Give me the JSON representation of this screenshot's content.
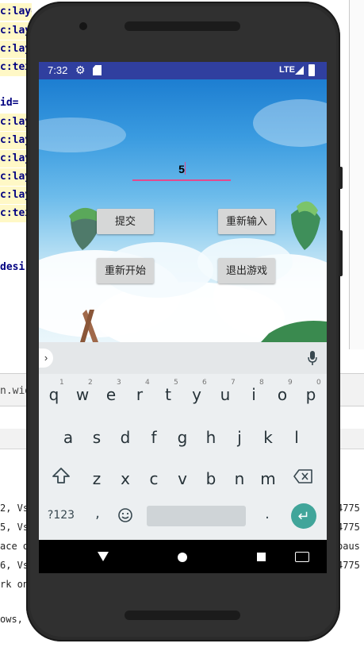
{
  "ide": {
    "code_lines": [
      "c:layou",
      "c:lay",
      "c:lay",
      "c:tex",
      "",
      "id=",
      "c:lay",
      "c:lay",
      "c:lay",
      "c:lay",
      "c:lay",
      "c:tex",
      "",
      "",
      "desi"
    ],
    "tab_text": "n.wid",
    "log_lines": [
      {
        "left": "2, Vs",
        "right": "4775"
      },
      {
        "left": "5, Vs",
        "right": "4775"
      },
      {
        "left": "ace o",
        "right": "paus"
      },
      {
        "left": "6, Vs",
        "right": "4775"
      },
      {
        "left": "rk on",
        "right": ""
      },
      {
        "left": "ows,",
        "right": ""
      }
    ]
  },
  "status_bar": {
    "time": "7:32",
    "network": "LTE",
    "icons": [
      "gear-icon",
      "sd-card-icon",
      "signal-icon",
      "battery-icon"
    ],
    "color": "#303f9f"
  },
  "app": {
    "input_value": "5",
    "buttons": {
      "submit": "提交",
      "reenter": "重新输入",
      "restart": "重新开始",
      "quit": "退出游戏"
    },
    "accent_color": "#e24a8d"
  },
  "keyboard": {
    "row1": [
      "q",
      "w",
      "e",
      "r",
      "t",
      "y",
      "u",
      "i",
      "o",
      "p"
    ],
    "row1_hints": [
      "1",
      "2",
      "3",
      "4",
      "5",
      "6",
      "7",
      "8",
      "9",
      "0"
    ],
    "row2": [
      "a",
      "s",
      "d",
      "f",
      "g",
      "h",
      "j",
      "k",
      "l"
    ],
    "row3": [
      "z",
      "x",
      "c",
      "v",
      "b",
      "n",
      "m"
    ],
    "symbols_key": "?123",
    "comma_key": ",",
    "period_key": ".",
    "emoji_icon": "emoji-icon",
    "enter_color": "#41a59a"
  },
  "navbar": {
    "icons": [
      "back-icon",
      "home-icon",
      "recents-icon",
      "keyboard-switch-icon"
    ]
  }
}
